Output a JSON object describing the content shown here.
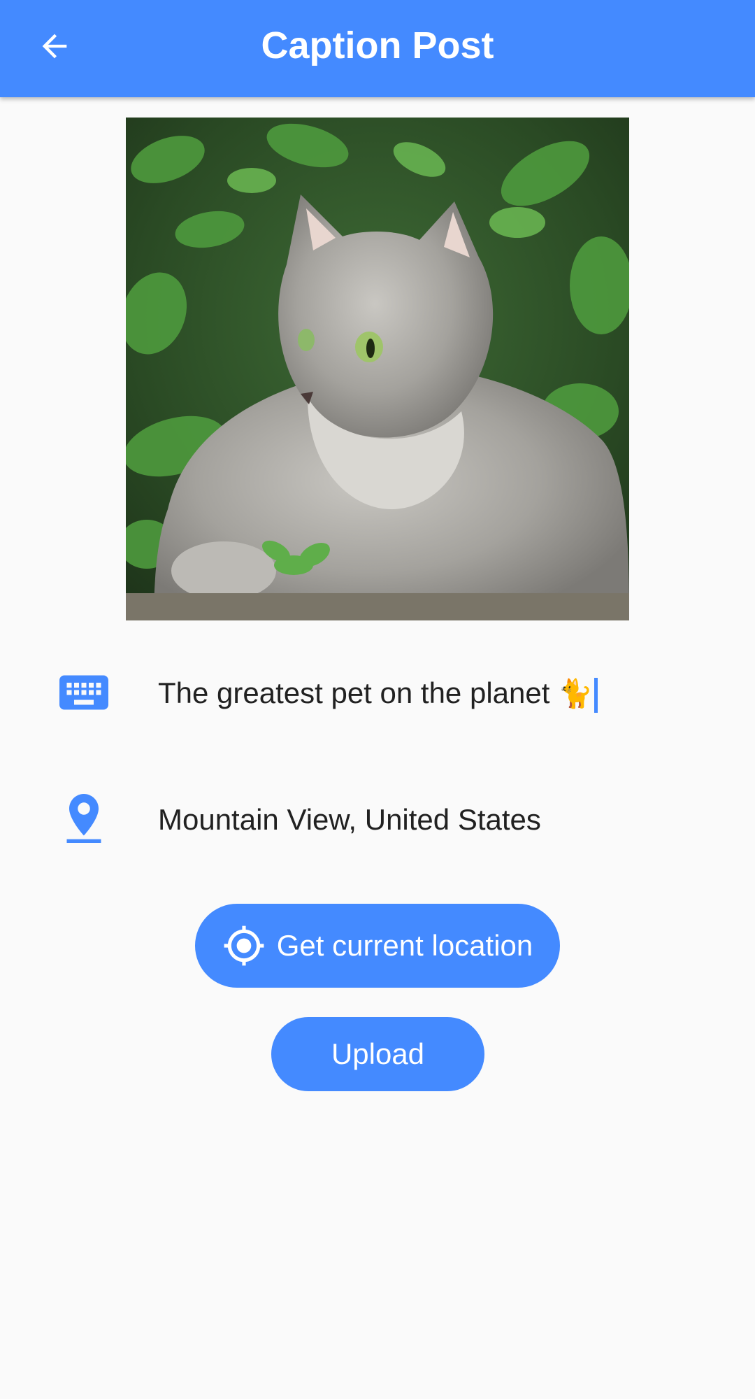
{
  "app_bar": {
    "title": "Caption Post",
    "back_icon": "arrow-back-icon",
    "background": "#448aff"
  },
  "photo": {
    "subject": "grey long-haired cat among green leaves"
  },
  "caption": {
    "icon": "keyboard-icon",
    "value": "The greatest pet on the planet",
    "emoji": "🐈"
  },
  "location": {
    "icon": "location-pin-icon",
    "value": "Mountain View, United States"
  },
  "buttons": {
    "get_location": {
      "label": "Get current location",
      "icon": "gps-target-icon"
    },
    "upload": {
      "label": "Upload"
    }
  },
  "colors": {
    "accent": "#448aff",
    "text": "#212121",
    "background": "#fafafa"
  }
}
